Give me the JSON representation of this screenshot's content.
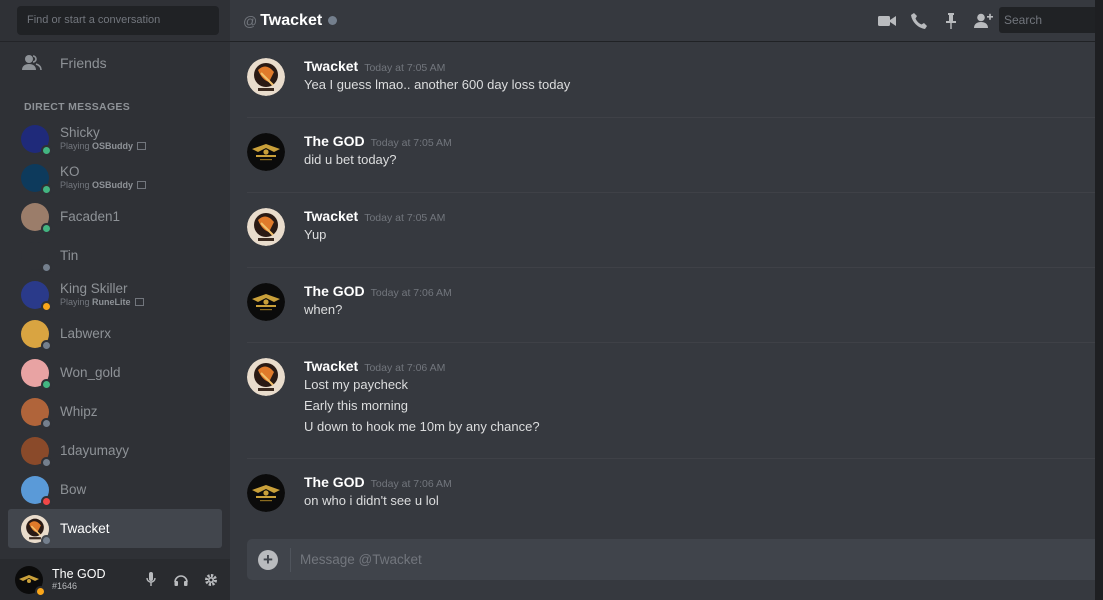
{
  "sidebar": {
    "search_placeholder": "Find or start a conversation",
    "friends_label": "Friends",
    "dm_header": "Direct Messages",
    "dms": [
      {
        "name": "Shicky",
        "activity_prefix": "Playing",
        "activity_game": "OSBuddy",
        "status": "online",
        "avatar_color": "#1f2a7a",
        "avatar_icon": "blue-creature-avatar"
      },
      {
        "name": "KO",
        "activity_prefix": "Playing",
        "activity_game": "OSBuddy",
        "status": "online",
        "avatar_color": "#0d3a5c",
        "avatar_icon": "ko-logo-avatar"
      },
      {
        "name": "Facaden1",
        "activity_prefix": "",
        "activity_game": "",
        "status": "online",
        "avatar_color": "#9b7d6a",
        "avatar_icon": "face-photo-avatar"
      },
      {
        "name": "Tin",
        "activity_prefix": "",
        "activity_game": "",
        "status": "offline",
        "avatar_color": "#2f3136",
        "avatar_icon": "tin-text-avatar"
      },
      {
        "name": "King Skiller",
        "activity_prefix": "Playing",
        "activity_game": "RuneLite",
        "status": "idle",
        "avatar_color": "#2a3a8a",
        "avatar_icon": "ghost-avatar"
      },
      {
        "name": "Labwerx",
        "activity_prefix": "",
        "activity_game": "",
        "status": "offline",
        "avatar_color": "#d9a441",
        "avatar_icon": "cartoon-avatar"
      },
      {
        "name": "Won_gold",
        "activity_prefix": "",
        "activity_game": "",
        "status": "online",
        "avatar_color": "#e8a3a3",
        "avatar_icon": "pink-flower-avatar"
      },
      {
        "name": "Whipz",
        "activity_prefix": "",
        "activity_game": "",
        "status": "offline",
        "avatar_color": "#b0643a",
        "avatar_icon": "warrior-avatar"
      },
      {
        "name": "1dayumayy",
        "activity_prefix": "",
        "activity_game": "",
        "status": "offline",
        "avatar_color": "#8a4a2a",
        "avatar_icon": "fire-avatar"
      },
      {
        "name": "Bow",
        "activity_prefix": "",
        "activity_game": "",
        "status": "dnd",
        "avatar_color": "#5a9ad8",
        "avatar_icon": "pepe-avatar"
      },
      {
        "name": "Twacket",
        "activity_prefix": "",
        "activity_game": "",
        "status": "offline",
        "avatar_color": "#d8c4b0",
        "avatar_icon": "guitar-avatar",
        "active": true
      }
    ],
    "user": {
      "name": "The GOD",
      "tag": "#1646",
      "status": "idle"
    }
  },
  "header": {
    "at_symbol": "@",
    "title": "Twacket",
    "search_placeholder": "Search",
    "icons": [
      "video-call-icon",
      "voice-call-icon",
      "pin-icon",
      "add-friend-icon"
    ]
  },
  "messages": [
    {
      "author": "Twacket",
      "time": "Today at 7:05 AM",
      "lines": [
        "Yea I guess lmao.. another 600 day loss today"
      ],
      "avatar": "twacket"
    },
    {
      "author": "The GOD",
      "time": "Today at 7:05 AM",
      "lines": [
        "did u bet today?"
      ],
      "avatar": "god"
    },
    {
      "author": "Twacket",
      "time": "Today at 7:05 AM",
      "lines": [
        "Yup"
      ],
      "avatar": "twacket"
    },
    {
      "author": "The GOD",
      "time": "Today at 7:06 AM",
      "lines": [
        "when?"
      ],
      "avatar": "god"
    },
    {
      "author": "Twacket",
      "time": "Today at 7:06 AM",
      "lines": [
        "Lost my paycheck",
        "Early this morning",
        "U down to hook me 10m by any chance?"
      ],
      "avatar": "twacket"
    },
    {
      "author": "The GOD",
      "time": "Today at 7:06 AM",
      "lines": [
        "on who i didn't see u lol"
      ],
      "avatar": "god"
    }
  ],
  "composer": {
    "placeholder": "Message @Twacket"
  },
  "colors": {
    "online": "#43b581",
    "idle": "#faa61a",
    "dnd": "#f04747",
    "offline": "#747f8d"
  }
}
